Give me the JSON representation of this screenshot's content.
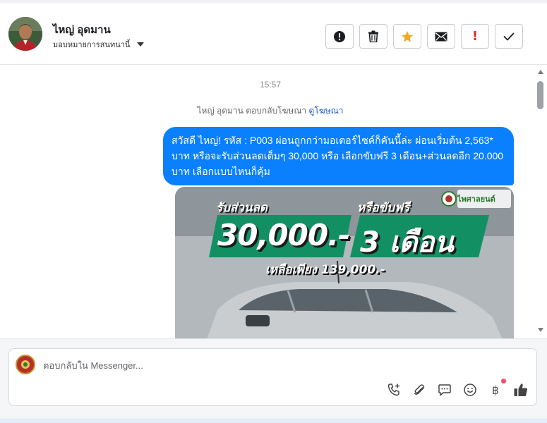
{
  "header": {
    "contact_name": "ไหญ่ อุดมาน",
    "assign_label": "มอบหมายการสนทนานี้",
    "toolbar": [
      {
        "name": "spam-button",
        "icon": "exclamation-circle-icon"
      },
      {
        "name": "delete-button",
        "icon": "trash-icon"
      },
      {
        "name": "star-button",
        "icon": "star-icon"
      },
      {
        "name": "mark-unread-button",
        "icon": "envelope-icon"
      },
      {
        "name": "follow-up-button",
        "icon": "exclamation-icon",
        "label": "!"
      },
      {
        "name": "mark-done-button",
        "icon": "check-icon"
      }
    ],
    "star_color": "#f5a623",
    "alert_color": "#e02a2a"
  },
  "conversation": {
    "timestamp": "15:57",
    "ad_reply_text": "ไหญ่ อุดมาน ตอบกลับโฆษณา",
    "ad_link": "ดูโฆษณา",
    "message": "สวัสดี ไหญ่! รหัส : P003 ผ่อนถูกกว่ามอเตอร์ไซค์ก็คันนี้ล่ะ ผ่อนเริ่มต้น 2,563* บาท หรือจะรับส่วนลดเต็มๆ 30,000 หรือ เลือกขับฟรี 3 เดือน+ส่วนลดอีก 20.000 บาท เลือกแบบไหนก็คุ้ม",
    "bubble_color": "#0b80ff",
    "ad_image": {
      "promo_label": "รับส่วนลด",
      "free_label": "หรือขับฟรี",
      "amount": "30,000.-",
      "months": "3 เดือน",
      "price": "เหลือเพียง 139,000.-",
      "logo_text": "ไพศาลยนต์"
    }
  },
  "composer": {
    "placeholder": "ตอบกลับใน Messenger...",
    "tools": [
      "phone-plus-icon",
      "paperclip-icon",
      "chat-bubble-icon",
      "smiley-icon",
      "baht-icon",
      "thumbs-up-icon"
    ],
    "baht_symbol": "฿"
  }
}
